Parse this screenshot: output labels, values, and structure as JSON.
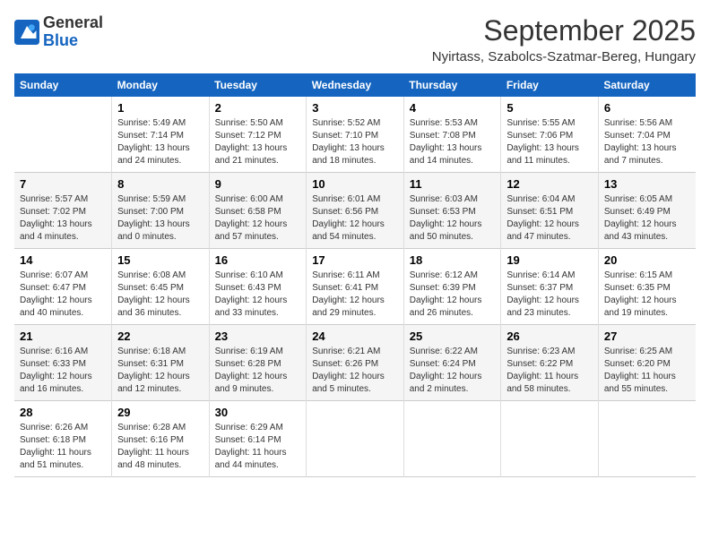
{
  "header": {
    "logo_general": "General",
    "logo_blue": "Blue",
    "month_title": "September 2025",
    "location": "Nyirtass, Szabolcs-Szatmar-Bereg, Hungary"
  },
  "calendar": {
    "days_of_week": [
      "Sunday",
      "Monday",
      "Tuesday",
      "Wednesday",
      "Thursday",
      "Friday",
      "Saturday"
    ],
    "weeks": [
      [
        {
          "day": "",
          "info": ""
        },
        {
          "day": "1",
          "info": "Sunrise: 5:49 AM\nSunset: 7:14 PM\nDaylight: 13 hours and 24 minutes."
        },
        {
          "day": "2",
          "info": "Sunrise: 5:50 AM\nSunset: 7:12 PM\nDaylight: 13 hours and 21 minutes."
        },
        {
          "day": "3",
          "info": "Sunrise: 5:52 AM\nSunset: 7:10 PM\nDaylight: 13 hours and 18 minutes."
        },
        {
          "day": "4",
          "info": "Sunrise: 5:53 AM\nSunset: 7:08 PM\nDaylight: 13 hours and 14 minutes."
        },
        {
          "day": "5",
          "info": "Sunrise: 5:55 AM\nSunset: 7:06 PM\nDaylight: 13 hours and 11 minutes."
        },
        {
          "day": "6",
          "info": "Sunrise: 5:56 AM\nSunset: 7:04 PM\nDaylight: 13 hours and 7 minutes."
        }
      ],
      [
        {
          "day": "7",
          "info": "Sunrise: 5:57 AM\nSunset: 7:02 PM\nDaylight: 13 hours and 4 minutes."
        },
        {
          "day": "8",
          "info": "Sunrise: 5:59 AM\nSunset: 7:00 PM\nDaylight: 13 hours and 0 minutes."
        },
        {
          "day": "9",
          "info": "Sunrise: 6:00 AM\nSunset: 6:58 PM\nDaylight: 12 hours and 57 minutes."
        },
        {
          "day": "10",
          "info": "Sunrise: 6:01 AM\nSunset: 6:56 PM\nDaylight: 12 hours and 54 minutes."
        },
        {
          "day": "11",
          "info": "Sunrise: 6:03 AM\nSunset: 6:53 PM\nDaylight: 12 hours and 50 minutes."
        },
        {
          "day": "12",
          "info": "Sunrise: 6:04 AM\nSunset: 6:51 PM\nDaylight: 12 hours and 47 minutes."
        },
        {
          "day": "13",
          "info": "Sunrise: 6:05 AM\nSunset: 6:49 PM\nDaylight: 12 hours and 43 minutes."
        }
      ],
      [
        {
          "day": "14",
          "info": "Sunrise: 6:07 AM\nSunset: 6:47 PM\nDaylight: 12 hours and 40 minutes."
        },
        {
          "day": "15",
          "info": "Sunrise: 6:08 AM\nSunset: 6:45 PM\nDaylight: 12 hours and 36 minutes."
        },
        {
          "day": "16",
          "info": "Sunrise: 6:10 AM\nSunset: 6:43 PM\nDaylight: 12 hours and 33 minutes."
        },
        {
          "day": "17",
          "info": "Sunrise: 6:11 AM\nSunset: 6:41 PM\nDaylight: 12 hours and 29 minutes."
        },
        {
          "day": "18",
          "info": "Sunrise: 6:12 AM\nSunset: 6:39 PM\nDaylight: 12 hours and 26 minutes."
        },
        {
          "day": "19",
          "info": "Sunrise: 6:14 AM\nSunset: 6:37 PM\nDaylight: 12 hours and 23 minutes."
        },
        {
          "day": "20",
          "info": "Sunrise: 6:15 AM\nSunset: 6:35 PM\nDaylight: 12 hours and 19 minutes."
        }
      ],
      [
        {
          "day": "21",
          "info": "Sunrise: 6:16 AM\nSunset: 6:33 PM\nDaylight: 12 hours and 16 minutes."
        },
        {
          "day": "22",
          "info": "Sunrise: 6:18 AM\nSunset: 6:31 PM\nDaylight: 12 hours and 12 minutes."
        },
        {
          "day": "23",
          "info": "Sunrise: 6:19 AM\nSunset: 6:28 PM\nDaylight: 12 hours and 9 minutes."
        },
        {
          "day": "24",
          "info": "Sunrise: 6:21 AM\nSunset: 6:26 PM\nDaylight: 12 hours and 5 minutes."
        },
        {
          "day": "25",
          "info": "Sunrise: 6:22 AM\nSunset: 6:24 PM\nDaylight: 12 hours and 2 minutes."
        },
        {
          "day": "26",
          "info": "Sunrise: 6:23 AM\nSunset: 6:22 PM\nDaylight: 11 hours and 58 minutes."
        },
        {
          "day": "27",
          "info": "Sunrise: 6:25 AM\nSunset: 6:20 PM\nDaylight: 11 hours and 55 minutes."
        }
      ],
      [
        {
          "day": "28",
          "info": "Sunrise: 6:26 AM\nSunset: 6:18 PM\nDaylight: 11 hours and 51 minutes."
        },
        {
          "day": "29",
          "info": "Sunrise: 6:28 AM\nSunset: 6:16 PM\nDaylight: 11 hours and 48 minutes."
        },
        {
          "day": "30",
          "info": "Sunrise: 6:29 AM\nSunset: 6:14 PM\nDaylight: 11 hours and 44 minutes."
        },
        {
          "day": "",
          "info": ""
        },
        {
          "day": "",
          "info": ""
        },
        {
          "day": "",
          "info": ""
        },
        {
          "day": "",
          "info": ""
        }
      ]
    ]
  }
}
